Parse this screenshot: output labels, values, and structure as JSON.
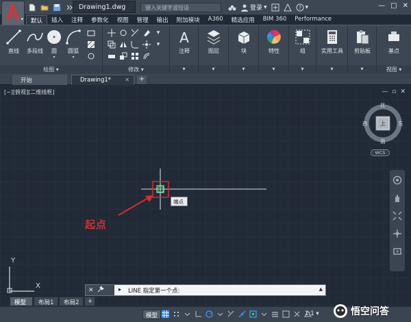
{
  "title_bar": {
    "document_title": "Drawing1.dwg",
    "search_placeholder": "键入关键字或短语",
    "login_label": "登录",
    "win_min": "—",
    "win_max": "□",
    "win_close": "✕"
  },
  "ribbon_tabs": [
    "默认",
    "插入",
    "注释",
    "参数化",
    "视图",
    "管理",
    "输出",
    "附加模块",
    "A360",
    "精选应用",
    "BIM 360",
    "Performance"
  ],
  "ribbon": {
    "draw_tools": [
      "直线",
      "多段线",
      "圆",
      "圆弧"
    ],
    "draw_panel_title": "绘图 ▾",
    "modify_panel_title": "修改 ▾",
    "annotation_label": "注释",
    "layer_label": "图层",
    "block_label": "块",
    "properties_label": "特性",
    "group_label": "组",
    "utilities_label": "实用工具",
    "clipboard_label": "剪贴板",
    "base_label": "基点",
    "view_panel_title": "视图 ▾"
  },
  "document_tabs": {
    "start": "开始",
    "drawing": "Drawing1*",
    "close": "✕",
    "new": "+"
  },
  "viewport": {
    "label": "[−][俯视][二维线框]",
    "ctrl_min": "—",
    "ctrl_restore": "▫",
    "ctrl_close": "✕",
    "compass": {
      "north": "北",
      "south": "南",
      "east": "东",
      "west": "西",
      "top": "上"
    },
    "wcs_label": "WCS",
    "tooltip": "端点",
    "annotation": "起点",
    "ucs_y": "Y",
    "ucs_x": "X"
  },
  "command_line": {
    "close": "✕",
    "prompt": "▸",
    "text": "LINE 指定第一个点:",
    "history_arrow": "▲"
  },
  "layout_tabs": [
    "模型",
    "布局1",
    "布局2",
    "+"
  ],
  "status_bar": {
    "model_label": "模型",
    "scale_label": "1:1 ▾"
  },
  "watermark": {
    "text": "悟空问答"
  },
  "colors": {
    "canvas": "#212a36",
    "ribbon": "#3d4754",
    "annotation_red": "#d62d2d",
    "snap_green": "#2fd04a",
    "accent_blue": "#3b8ee8"
  }
}
